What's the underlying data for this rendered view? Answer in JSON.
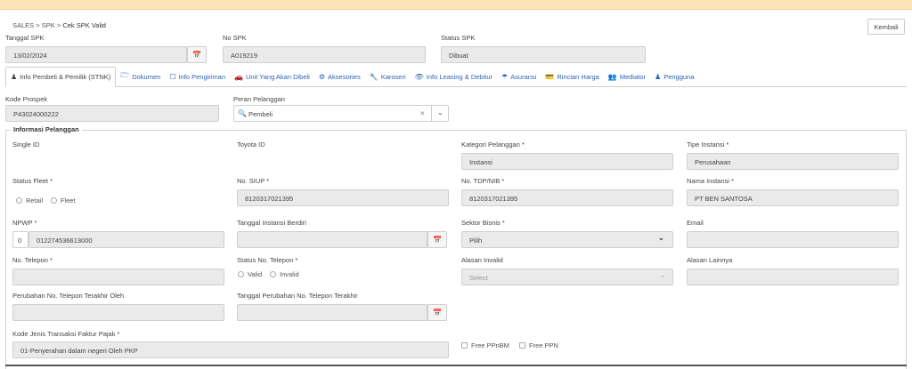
{
  "breadcrumb": {
    "a": "SALES",
    "b": "SPK",
    "c": "Cek SPK Valid"
  },
  "header": {
    "tanggal_spk_label": "Tanggal SPK",
    "tanggal_spk_value": "13/02/2024",
    "no_spk_label": "No SPK",
    "no_spk_value": "A019219",
    "status_spk_label": "Status SPK",
    "status_spk_value": "Dibuat",
    "kembali": "Kembali"
  },
  "tabs": [
    {
      "label": "Info Pembeli & Pemilik (STNK)",
      "icon": "user-icon"
    },
    {
      "label": "Dokumen",
      "icon": "folder-icon"
    },
    {
      "label": "Info Pengiriman",
      "icon": "calendar-icon"
    },
    {
      "label": "Unit Yang Akan Dibeli",
      "icon": "car-icon"
    },
    {
      "label": "Aksesories",
      "icon": "gears-icon"
    },
    {
      "label": "Karoseri",
      "icon": "wrench-icon"
    },
    {
      "label": "Info Leasing & Debitur",
      "icon": "eye-icon"
    },
    {
      "label": "Asuransi",
      "icon": "umbrella-icon"
    },
    {
      "label": "Rincian Harga",
      "icon": "card-icon"
    },
    {
      "label": "Mediator",
      "icon": "users-icon"
    },
    {
      "label": "Pengguna",
      "icon": "user-icon"
    }
  ],
  "kode_prospek": {
    "label": "Kode Prospek",
    "value": "P43024000222"
  },
  "peran": {
    "label": "Peran Pelanggan",
    "value": "Pembeli"
  },
  "section_title": "Informasi Pelanggan",
  "fields": {
    "single_id": "Single ID",
    "toyota_id": "Toyota ID",
    "kategori": {
      "label": "Kategori Pelanggan *",
      "value": "Instansi"
    },
    "tipe_instansi": {
      "label": "Tipe Instansi *",
      "value": "Perusahaan"
    },
    "status_fleet": {
      "label": "Status Fleet *",
      "opt1": "Retail",
      "opt2": "Fleet"
    },
    "siup": {
      "label": "No. SIUP *",
      "value": "8120317021395"
    },
    "tdp": {
      "label": "No. TDP/NIB *",
      "value": "8120317021395"
    },
    "nama_instansi": {
      "label": "Nama Instansi *",
      "value": "PT BEN SANTOSA"
    },
    "npwp": {
      "label": "NPWP *",
      "prefix": "0",
      "value": "012274536613000"
    },
    "tanggal_instansi": {
      "label": "Tanggal Instansi Berdiri"
    },
    "sektor": {
      "label": "Sektor Bisnis *",
      "value": "Pilih"
    },
    "email": {
      "label": "Email"
    },
    "telepon": {
      "label": "No. Telepon *"
    },
    "status_telepon": {
      "label": "Status No. Telepon *",
      "opt1": "Valid",
      "opt2": "Invalid"
    },
    "alasan_invalid": {
      "label": "Alasan Invalid",
      "placeholder": "Select"
    },
    "alasan_lainnya": {
      "label": "Alasan Lainnya"
    },
    "perubahan_oleh": {
      "label": "Perubahan No. Telepon Terakhir Oleh"
    },
    "tanggal_perubahan": {
      "label": "Tanggal Perubahan No. Telepon Terakhir"
    },
    "kode_faktur": {
      "label": "Kode Jenis Transaksi Faktur Pajak *",
      "value": "01-Penyerahan dalam negeri Oleh PKP"
    },
    "free_ppnbm": "Free PPnBM",
    "free_ppn": "Free PPN"
  }
}
